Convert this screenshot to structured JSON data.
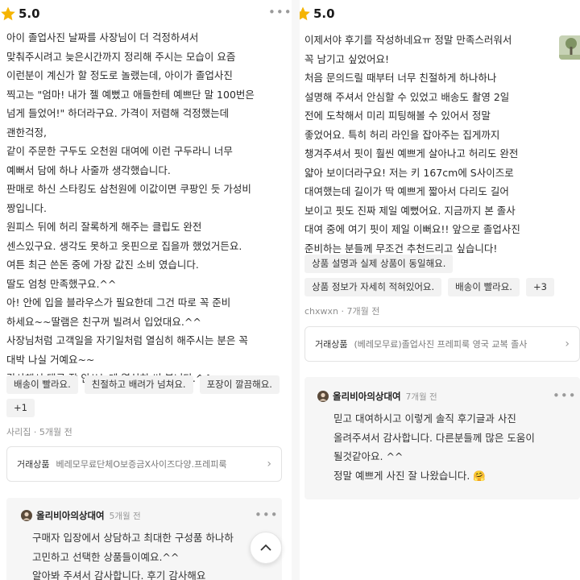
{
  "left": {
    "rating": "5.0",
    "more": "•••",
    "review_lines": [
      "아이 졸업사진 날짜를 사장님이 더 걱정하셔서",
      "맞춰주시려고 늦은시간까지 정리해 주시는 모습이 요즘",
      "이런분이 계신가 할 정도로 놀랬는데, 아이가 졸업사진",
      "찍고는 \"엄마! 내가 젤 예뻤고 애들한테 예쁘단 말 100번은",
      "넘게 들었어!\" 하더라구요. 가격이 저렴해 걱정했는데",
      "괜한걱정,",
      "같이 주문한 구두도 오천원 대여에 이런 구두라니 너무",
      "예뻐서 담에 하나 사줄까 생각했습니다.",
      "판매로 하신 스타킹도 삼천원에 이값이면 쿠팡인 듯 가성비",
      "짱입니다.",
      "원피스 뒤에  허리 잘록하게 해주는 클립도 완전",
      "센스있구요. 생각도 못하고 옷핀으로 집을까 했었거든요.",
      "여튼 최근 쓴돈 중에 가장 값진 소비 였습니다.",
      "딸도 엄청 만족했구요.^^",
      "아! 안에 입을 블라우스가 필요한데 그건 따로 꼭 준비",
      "하세요~~딸램은 친구꺼 빌려서 입었대요.^^",
      "사장님처럼 고객일을 자기일처럼 열심히 해주시는 분은 꼭",
      "대박 나실 거예요~~",
      "감사해서 댓글 잘 안쓰는데 열심히 써 봅니다.^^"
    ],
    "tags": [
      "배송이 빨라요.",
      "친절하고 배려가 넘쳐요.",
      "포장이 깔끔해요.",
      "+1"
    ],
    "reviewer": "사리집",
    "time": "5개월 전",
    "product_label": "거래상품",
    "product_name": "베레모무료단체O보증금X사이즈다양.프레피룩",
    "seller": {
      "name": "올리비아의상대여",
      "time": "5개월 전",
      "more": "•••",
      "reply_lines": [
        "구매자 입장에서 상담하고 최대한 구성품 하나하",
        "고민하고 선택한 상품들이예요.^^",
        "알아봐 주셔서 감사합니다. 후기 감사해요"
      ]
    }
  },
  "right": {
    "rating": "5.0",
    "review_lines": [
      "이제서야 후기를 작성하네요ㅠ 정말 만족스러워서",
      "꼭 남기고 싶었어요!",
      "처음 문의드릴 때부터 너무 친절하게 하나하나",
      "설명해 주셔서 안심할 수 있었고 배송도 촬영 2일",
      "전에 도착해서 미리 피팅해볼 수 있어서 정말",
      "좋었어요. 특히 허리 라인을 잡아주는 집게까지",
      "챙겨주셔서 핏이 훨씬 예쁘게 살아나고 허리도 완전",
      "얇아 보이더라구요! 저는 키 167cm에 S사이즈로",
      "대여했는데 길이가 딱 예쁘게 짧아서 다리도 길어",
      "보이고 핏도 진짜 제일 예뻤어요. 지금까지 본 졸사",
      "대여 중에 여기 핏이 제일 이뻐요!! 앞으로 졸업사진",
      "준비하는 분들께 무조건 추천드리고 싶습니다!"
    ],
    "tags": [
      "상품 설명과 실제 상품이 동일해요.",
      "상품 정보가 자세히 적혀있어요.",
      "배송이 빨라요.",
      "+3"
    ],
    "reviewer": "chxwxn",
    "time": "7개월 전",
    "product_label": "거래상품",
    "product_name": "(베레모무료)졸업사진 프레피룩 영국 교복 졸사",
    "seller": {
      "name": "올리비아의상대여",
      "time": "7개월 전",
      "more": "•••",
      "reply_lines": [
        "믿고 대여하시고 이렇게 솔직 후기글과 사진",
        "올려주셔서 감사합니다. 다른분들께 많은 도움이",
        "될것같아요. ^^",
        "정말 예쁘게 사진 잘 나왔습니다. 🤗"
      ]
    }
  },
  "icons": {
    "star": "star-icon",
    "chevron": "chevron-right-icon",
    "up": "chevron-up-icon"
  },
  "colors": {
    "star": "#f5b400",
    "chip_bg": "#f2f2f2",
    "reply_bg": "#f6f6f6"
  }
}
